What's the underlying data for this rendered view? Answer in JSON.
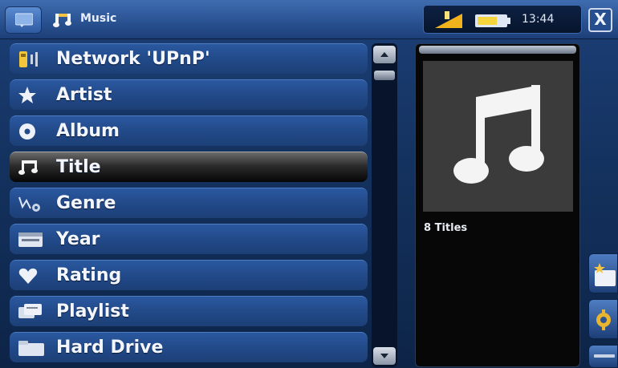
{
  "header": {
    "title": "Music",
    "clock": "13:44",
    "close_glyph": "X",
    "menu_icon": "menu-icon",
    "title_icon": "music-note-icon"
  },
  "list": {
    "items": [
      {
        "label": "Network 'UPnP'",
        "icon": "network-icon",
        "selected": false
      },
      {
        "label": "Artist",
        "icon": "star-icon",
        "selected": false
      },
      {
        "label": "Album",
        "icon": "disc-icon",
        "selected": false
      },
      {
        "label": "Title",
        "icon": "music-note-icon",
        "selected": true
      },
      {
        "label": "Genre",
        "icon": "genre-icon",
        "selected": false
      },
      {
        "label": "Year",
        "icon": "calendar-icon",
        "selected": false
      },
      {
        "label": "Rating",
        "icon": "heart-icon",
        "selected": false
      },
      {
        "label": "Playlist",
        "icon": "playlist-icon",
        "selected": false
      },
      {
        "label": "Hard Drive",
        "icon": "folder-icon",
        "selected": false
      }
    ]
  },
  "preview": {
    "count_label": "8 Titles",
    "art_icon": "music-note-icon"
  },
  "colors": {
    "row_blue": "#224a89",
    "selected_black": "#050505",
    "panel_black": "#070707",
    "art_gray": "#3b3b3b"
  }
}
